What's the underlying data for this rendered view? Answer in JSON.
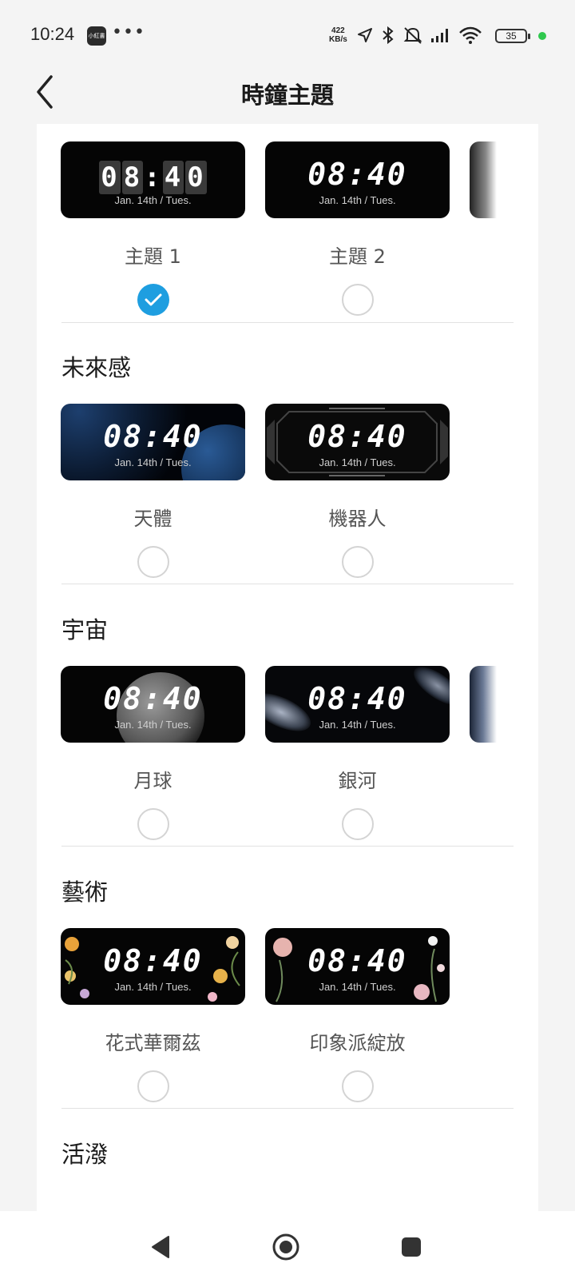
{
  "status_bar": {
    "time": "10:24",
    "app_icon_text": "小紅書",
    "more": "•••",
    "net_speed_value": "422",
    "net_speed_unit": "KB/s",
    "battery": "35"
  },
  "header": {
    "title": "時鐘主題"
  },
  "clock_time": "08:40",
  "clock_date": "Jan. 14th / Tues.",
  "sections": [
    {
      "title": "",
      "themes": [
        {
          "label": "主題 1",
          "selected": true
        },
        {
          "label": "主題 2",
          "selected": false
        }
      ]
    },
    {
      "title": "未來感",
      "themes": [
        {
          "label": "天體",
          "selected": false
        },
        {
          "label": "機器人",
          "selected": false
        }
      ]
    },
    {
      "title": "宇宙",
      "themes": [
        {
          "label": "月球",
          "selected": false
        },
        {
          "label": "銀河",
          "selected": false
        }
      ]
    },
    {
      "title": "藝術",
      "themes": [
        {
          "label": "花式華爾茲",
          "selected": false
        },
        {
          "label": "印象派綻放",
          "selected": false
        }
      ]
    },
    {
      "title": "活潑",
      "themes": []
    }
  ],
  "colors": {
    "accent": "#1e9ee0",
    "card": "#ffffff",
    "background": "#f4f4f4"
  },
  "icons": {
    "back": "chevron-left-icon",
    "nav_back": "triangle-back-icon",
    "nav_home": "circle-home-icon",
    "nav_recents": "square-recents-icon"
  }
}
